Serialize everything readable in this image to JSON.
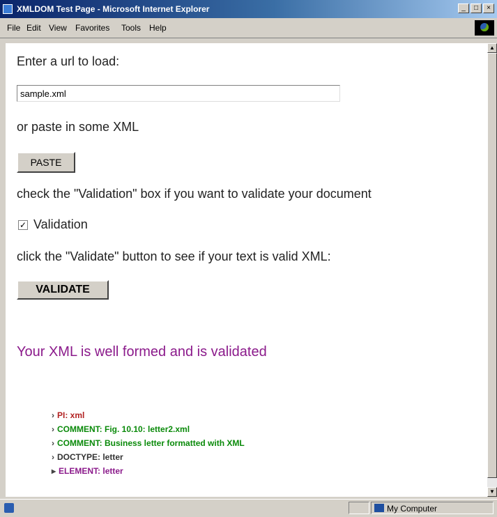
{
  "window": {
    "title": "XMLDOM Test Page - Microsoft Internet Explorer",
    "buttons": [
      "_",
      "□",
      "×"
    ]
  },
  "menubar": {
    "items": [
      "File",
      "Edit",
      "View",
      "Favorites",
      "Tools",
      "Help"
    ]
  },
  "page": {
    "url_prompt": "Enter a url to load:",
    "url_value": "sample.xml",
    "paste_prompt": "or paste in some XML",
    "paste_label": "PASTE",
    "validation_prompt": "check the \"Validation\" box if you want to validate your document",
    "validation_checkbox": "Validation",
    "validation_checked": true,
    "validate_prompt": "click the \"Validate\" button to see if your text is valid XML:",
    "validate_label": "VALIDATE",
    "result_message": "Your XML is well formed and is validated",
    "result_color": "#8b1a8b"
  },
  "tree": [
    {
      "text": "PI: xml",
      "color": "#b22222"
    },
    {
      "text": "COMMENT: Fig. 10.10: letter2.xml",
      "color": "#0a8a0a"
    },
    {
      "text": "COMMENT: Business letter formatted with XML",
      "color": "#0a8a0a"
    },
    {
      "text": "DOCTYPE: letter",
      "color": "#333333"
    },
    {
      "text": "ELEMENT: letter",
      "color": "#8b1a8b"
    }
  ],
  "statusbar": {
    "zone": "My Computer"
  }
}
